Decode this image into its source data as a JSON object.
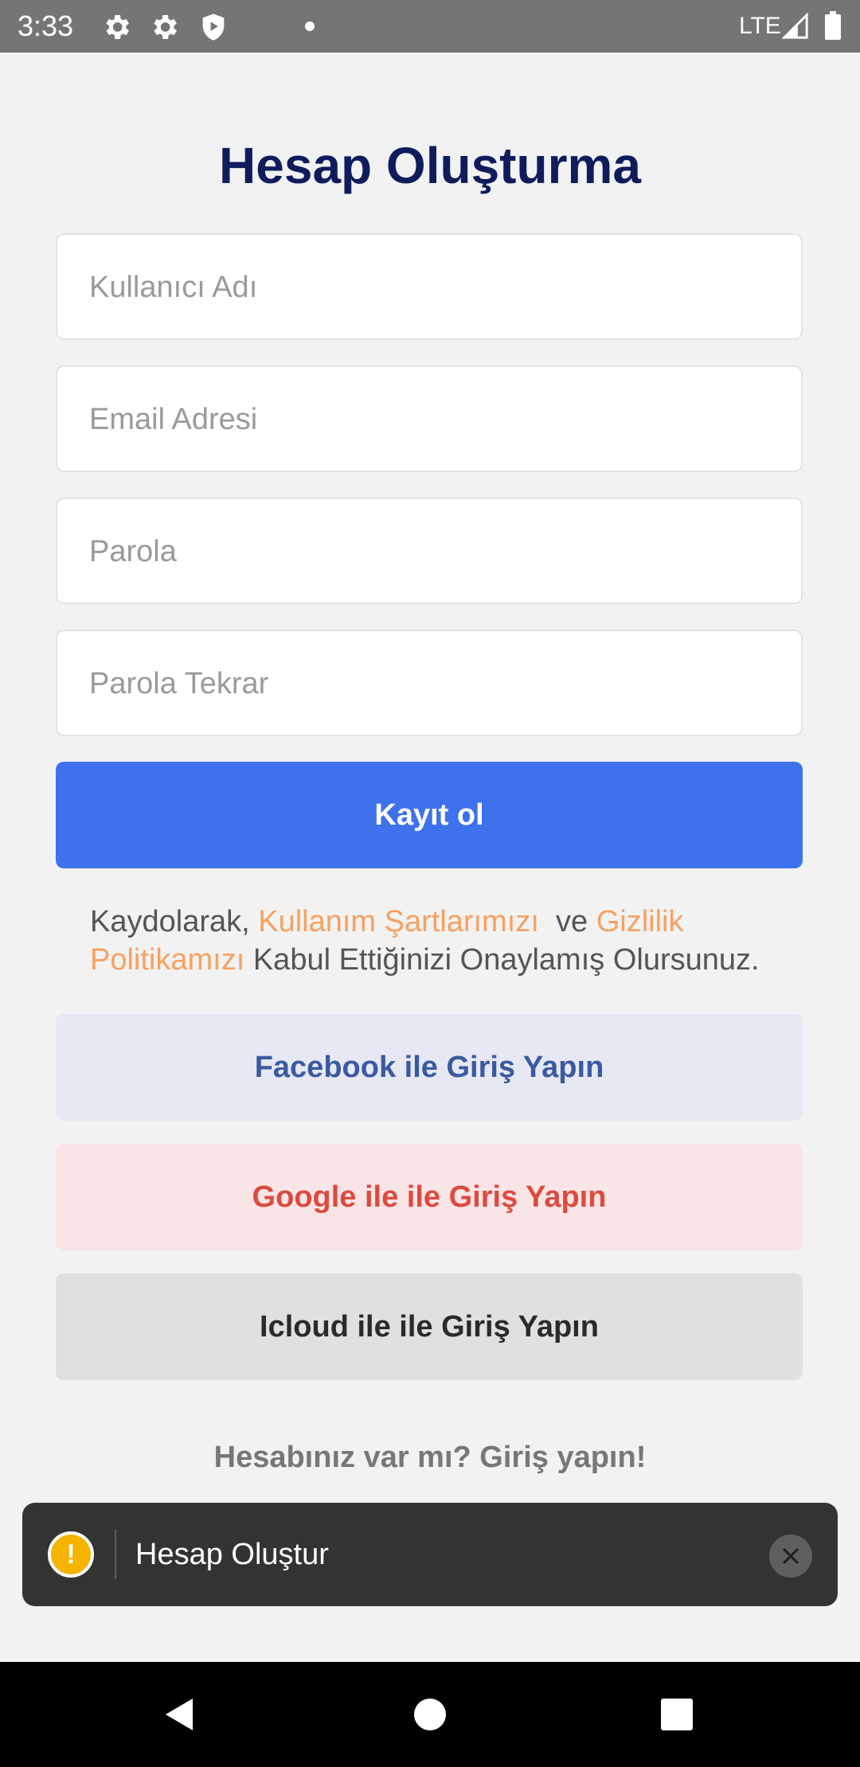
{
  "status_bar": {
    "time": "3:33",
    "icons": [
      "gear-icon",
      "gear-icon",
      "shield-play-icon",
      "notification-dot-icon"
    ],
    "network": "LTE",
    "signal_icon": "signal-icon",
    "battery_icon": "battery-icon"
  },
  "page": {
    "title": "Hesap Oluşturma"
  },
  "form": {
    "username_placeholder": "Kullanıcı Adı",
    "email_placeholder": "Email Adresi",
    "password_placeholder": "Parola",
    "password_repeat_placeholder": "Parola Tekrar",
    "submit_label": "Kayıt ol"
  },
  "terms": {
    "prefix": "Kaydolarak, ",
    "terms_link": "Kullanım Şartlarımızı",
    "middle": "  ve ",
    "privacy_link": "Gizlilik Politikamızı",
    "suffix": " Kabul Ettiğinizi Onaylamış Olursunuz."
  },
  "social": {
    "facebook_label": "Facebook ile Giriş Yapın",
    "google_label": "Google ile ile Giriş Yapın",
    "icloud_label": "Icloud ile ile Giriş Yapın"
  },
  "login_prompt": "Hesabınız var mı? Giriş yapın!",
  "toast": {
    "icon": "warning-icon",
    "icon_glyph": "!",
    "message": "Hesap Oluştur",
    "close_icon": "close-icon"
  },
  "nav_bar": {
    "back_icon": "back-icon",
    "home_icon": "home-icon",
    "recents_icon": "recents-icon"
  },
  "colors": {
    "primary": "#3d72ec",
    "title": "#0f1c5c",
    "link": "#f7a160",
    "facebook": "#3b5aa0",
    "google": "#dc4b40"
  }
}
